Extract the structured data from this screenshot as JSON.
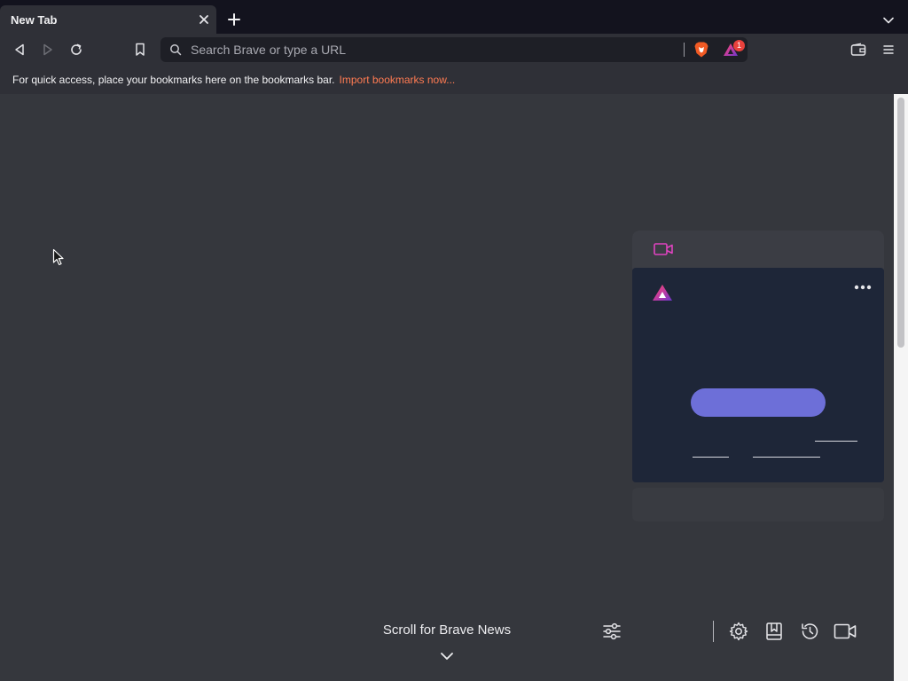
{
  "tab": {
    "title": "New Tab"
  },
  "toolbar": {
    "search_placeholder": "Search Brave or type a URL",
    "rewards_badge": "1"
  },
  "bookmarks_bar": {
    "message": "For quick access, place your bookmarks here on the bookmarks bar.",
    "import_link": "Import bookmarks now..."
  },
  "bottom": {
    "scroll_news_label": "Scroll for Brave News"
  },
  "icons": {
    "back": "back-icon",
    "forward": "forward-icon",
    "reload": "reload-icon",
    "bookmark": "bookmark-icon",
    "search": "search-icon",
    "brave_shields": "brave-shields-icon",
    "brave_rewards": "brave-rewards-icon",
    "wallet": "wallet-icon",
    "menu": "menu-icon",
    "close": "close-icon",
    "new_tab": "plus-icon",
    "tabs_menu": "chevron-down-icon",
    "video": "video-camera-icon",
    "settings": "gear-icon",
    "bookmarks_page": "bookmarks-icon",
    "history": "history-icon",
    "customize": "sliders-icon"
  },
  "colors": {
    "accent_orange": "#ff7b52",
    "cta_purple": "#6d6fd8",
    "brave_video_pink": "#e043c0"
  }
}
